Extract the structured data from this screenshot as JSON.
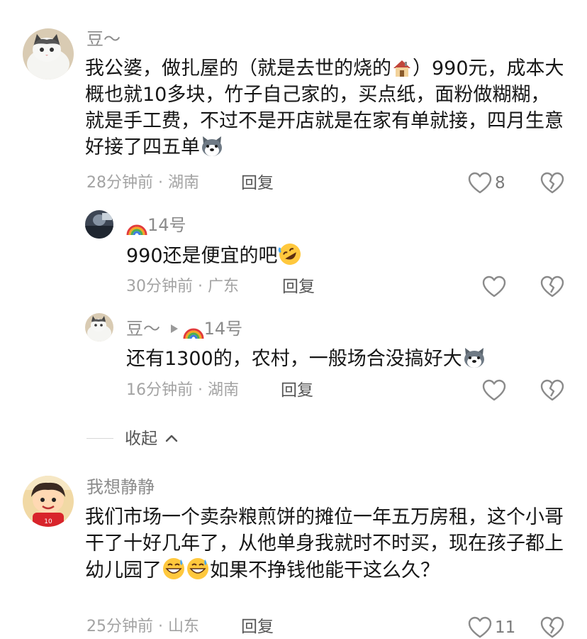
{
  "comments": [
    {
      "author": "豆～",
      "text_parts": [
        "我公婆，做扎屋的（就是去世的烧的",
        "）990元，成本大概也就10多块，竹子自己家的，买点纸，面粉做糊糊，就是手工费，不过不是开店就是在家有单就接，四月生意好接了四五单"
      ],
      "meta": "28分钟前 · 湖南",
      "reply_label": "回复",
      "likes": "8",
      "replies": [
        {
          "author": "14号",
          "text": "990还是便宜的吧",
          "meta": "30分钟前 · 广东",
          "reply_label": "回复"
        },
        {
          "author": "豆～",
          "reply_to": "14号",
          "text": "还有1300的，农村，一般场合没搞好大",
          "meta": "16分钟前 · 湖南",
          "reply_label": "回复"
        }
      ],
      "collapse_label": "收起"
    },
    {
      "author": "我想静静",
      "text_parts": [
        "我们市场一个卖杂粮煎饼的摊位一年五万房租，这个小哥干了十好几年了，从他单身我就时不时买，现在孩子都上幼儿园了",
        "如果不挣钱他能干这么久？"
      ],
      "meta": "25分钟前 · 山东",
      "reply_label": "回复",
      "likes": "11"
    }
  ],
  "icons": {
    "like": "heart-outline-icon",
    "dislike": "broken-heart-icon",
    "reply_arrow": "triangle-right-icon",
    "collapse": "chevron-up-icon",
    "rainbow": "rainbow-emoji",
    "house": "house-emoji",
    "dog": "dog-face-emoji",
    "laugh": "rofl-emoji",
    "grin_sweat": "grin-sweat-emoji"
  },
  "colors": {
    "name": "#8b8b8b",
    "text": "#161616",
    "meta": "#a3a3a3"
  }
}
